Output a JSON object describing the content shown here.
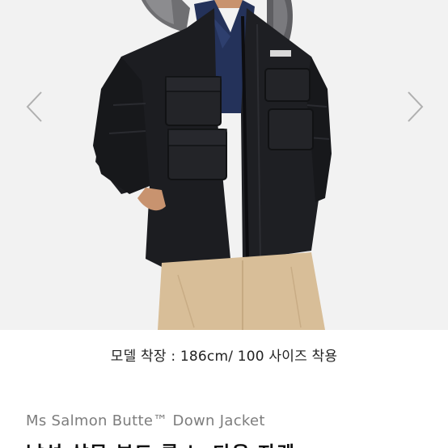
{
  "gallery": {
    "prev_icon": "chevron-left-icon",
    "next_icon": "chevron-right-icon",
    "arrow_color": "#b0b0b0",
    "background": "#f3f3f3"
  },
  "caption": {
    "model_fit": "모델 착장 : 186cm/ 100 사이즈 착용"
  },
  "product": {
    "name_en": "Ms Salmon Butte™ Down Jacket",
    "name_ko": "남성 살몬 뷰트 롱 노 다운 자켓"
  },
  "colors": {
    "jacket": "#1c1d21",
    "pants": "#d8be98",
    "shirt": "#24325a",
    "text_gray": "#7d7d7d"
  }
}
